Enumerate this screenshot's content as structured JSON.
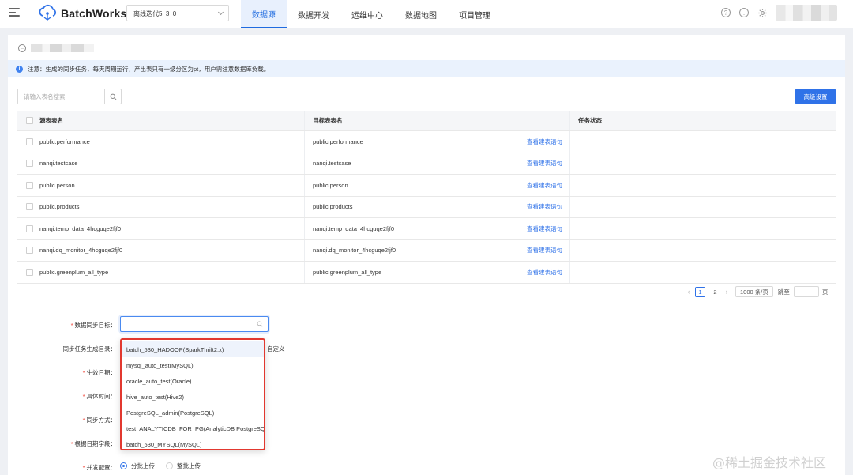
{
  "header": {
    "brand": "BatchWorks",
    "env_select": "离线迭代5_3_0",
    "nav": [
      "数据源",
      "数据开发",
      "运维中心",
      "数据地图",
      "项目管理"
    ],
    "active_nav": 0,
    "icons": [
      "help-icon",
      "message-icon",
      "settings-icon"
    ]
  },
  "notice": "注意：生成的同步任务，每天周期运行，产出表只有一级分区为pt，用户需注意数据库负载。",
  "search": {
    "placeholder": "请输入表名搜索"
  },
  "advanced_button": "高级设置",
  "table": {
    "headers": [
      "源表表名",
      "目标表表名",
      "任务状态"
    ],
    "link_label": "查看建表语句",
    "rows": [
      {
        "source": "public.performance",
        "target": "public.performance"
      },
      {
        "source": "nanqi.testcase",
        "target": "nanqi.testcase"
      },
      {
        "source": "public.person",
        "target": "public.person"
      },
      {
        "source": "public.products",
        "target": "public.products"
      },
      {
        "source": "nanqi.temp_data_4hcguqe2fjf0",
        "target": "nanqi.temp_data_4hcguqe2fjf0"
      },
      {
        "source": "nanqi.dq_monitor_4hcguqe2fjf0",
        "target": "nanqi.dq_monitor_4hcguqe2fjf0"
      },
      {
        "source": "public.greenplum_all_type",
        "target": "public.greenplum_all_type"
      }
    ]
  },
  "pagination": {
    "pages": [
      "1",
      "2"
    ],
    "current": "1",
    "page_size": "1000 条/页",
    "jump_label": "跳至",
    "page_suffix": "页"
  },
  "form": {
    "target_label": "数据同步目标：",
    "dir_label": "同步任务生成目录：",
    "dir_side_text": "自定义",
    "date_label": "生效日期：",
    "time_label": "具体时间：",
    "mode_label": "同步方式：",
    "date_field_label": "根据日期字段：",
    "concurrency_label": "并发配置：",
    "radio_batch": "分批上传",
    "radio_whole": "整批上传"
  },
  "dropdown": [
    "batch_530_HADOOP(SparkThrift2.x)",
    "mysql_auto_test(MySQL)",
    "oracle_auto_test(Oracle)",
    "hive_auto_test(Hive2)",
    "PostgreSQL_admin(PostgreSQL)",
    "test_ANALYTICDB_FOR_PG(AnalyticDB PostgreSQL)",
    "batch_530_MYSQL(MySQL)"
  ],
  "watermark": "@稀土掘金技术社区"
}
